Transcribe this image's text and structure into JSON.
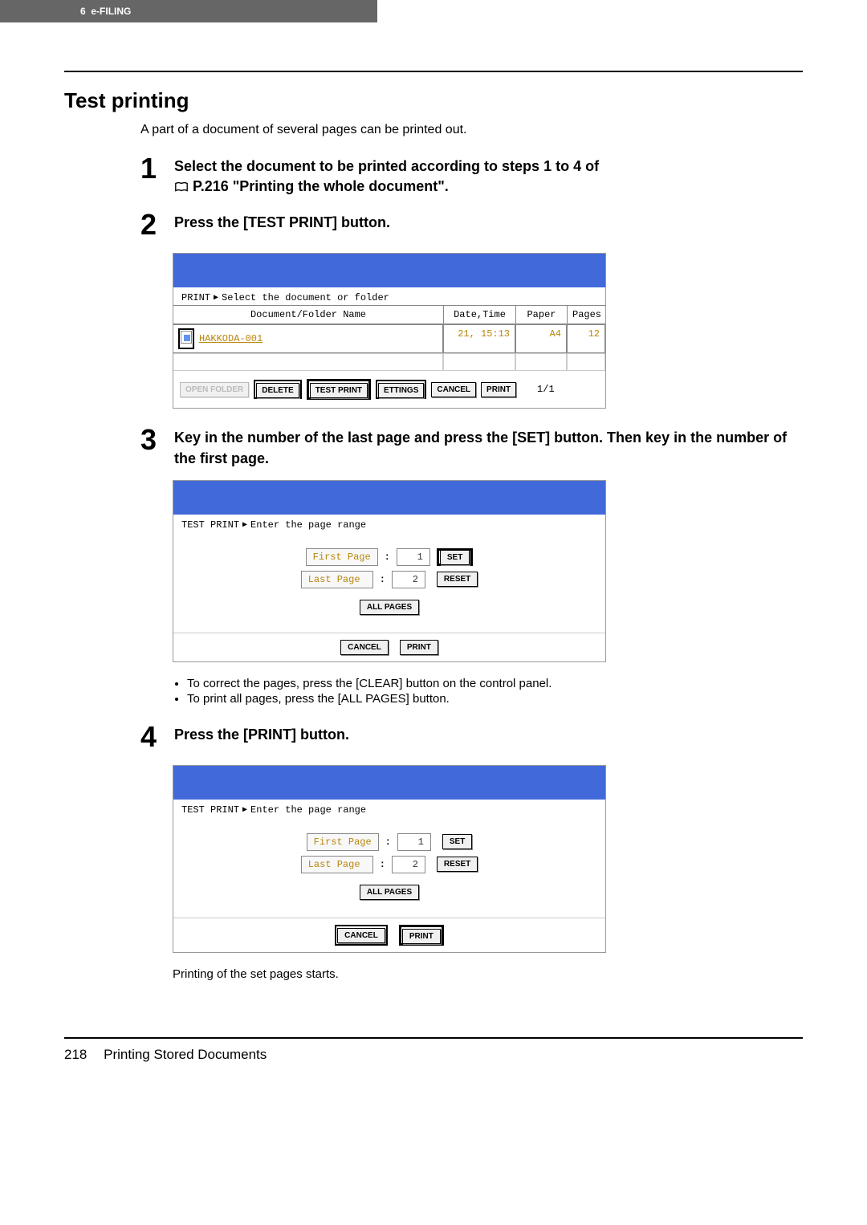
{
  "header": {
    "chapter": "6",
    "section": "e-FILING"
  },
  "title": "Test printing",
  "intro": "A part of a document of several pages can be printed out.",
  "steps": [
    {
      "num": "1",
      "title_line1": "Select the document to be printed according to steps 1 to 4 of",
      "title_line2": "P.216 \"Printing the whole document\"."
    },
    {
      "num": "2",
      "title": "Press the [TEST PRINT] button."
    },
    {
      "num": "3",
      "title": "Key in the number of the last page and press the [SET] button. Then key in the number of the first page."
    },
    {
      "num": "4",
      "title": "Press the [PRINT] button."
    }
  ],
  "screen1": {
    "breadcrumb_label": "PRINT",
    "breadcrumb_hint": "Select the document or folder",
    "cols": {
      "name": "Document/Folder Name",
      "date": "Date,Time",
      "paper": "Paper",
      "pages": "Pages"
    },
    "row": {
      "name": "HAKKODA-001",
      "date": "21, 15:13",
      "paper": "A4",
      "pages": "12"
    },
    "buttons": {
      "open": "OPEN FOLDER",
      "delete": "DELETE",
      "test": "TEST PRINT",
      "settings": "ETTINGS",
      "cancel": "CANCEL",
      "print": "PRINT"
    },
    "page_ind": "1/1"
  },
  "screen2": {
    "breadcrumb_label": "TEST PRINT",
    "breadcrumb_hint": "Enter the page range",
    "first_label": "First Page",
    "last_label": "Last Page",
    "first_val": "1",
    "last_val": "2",
    "set": "SET",
    "reset": "RESET",
    "all": "ALL PAGES",
    "cancel": "CANCEL",
    "print": "PRINT"
  },
  "bullets": [
    "To correct the pages, press the [CLEAR] button on the control panel.",
    "To print all pages, press the [ALL PAGES] button."
  ],
  "closing": "Printing of the set pages starts.",
  "footer": {
    "page": "218",
    "section": "Printing Stored Documents"
  }
}
